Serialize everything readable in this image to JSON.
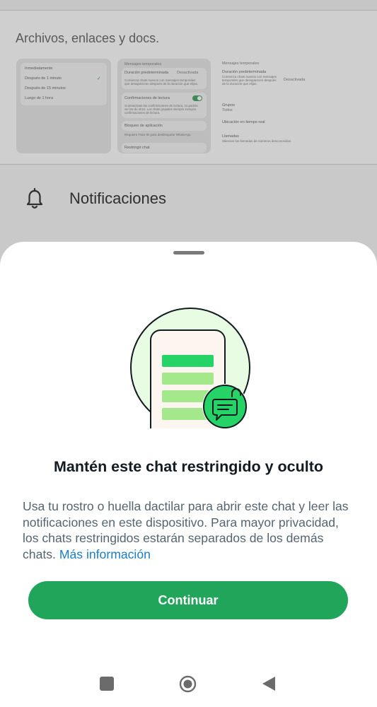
{
  "background": {
    "media_section_title": "Archivos, enlaces y docs.",
    "thumbnail_1": {
      "options": [
        "Inmediatamente",
        "Después de 1 minuto",
        "Después de 15 minutos",
        "Luego de 1 hora"
      ],
      "selected_check": "✓"
    },
    "thumbnail_2": {
      "section_label": "Mensajes temporales",
      "duration_label": "Duración predeterminada",
      "duration_value": "Desactivada",
      "duration_desc": "Comienza chats nuevos con mensajes temporales que desaparecen después de la duración que elijas.",
      "read_receipts_label": "Confirmaciones de lectura",
      "read_receipts_desc": "Si desactivas las confirmaciones de lectura, no podrás ver las de otros. Los chats grupales siempre incluyen confirmaciones de lectura.",
      "app_lock_label": "Bloqueo de aplicación",
      "app_lock_desc": "Requiere Face ID para desbloquear WhatsApp.",
      "restrict_chat_label": "Restringir chat"
    },
    "thumbnail_3": {
      "section_label": "Mensajes temporales",
      "duration_label": "Duración predeterminada",
      "duration_desc": "Comienza chats nuevos con mensajes temporales que desaparecen después de la duración que elijas.",
      "duration_value": "Desactivada",
      "groups_label": "Grupos",
      "groups_value": "Todos",
      "live_location_label": "Ubicación en tiempo real",
      "calls_label": "Llamadas",
      "calls_desc": "Silenciar los llamadas de números desconocidos"
    },
    "notifications_label": "Notificaciones"
  },
  "sheet": {
    "title": "Mantén este chat restringido y oculto",
    "body": "Usa tu rostro o huella dactilar para abrir este chat y leer las notificaciones en este dispositivo. Para mayor privacidad, los chats restringidos estarán separados de los demás chats.",
    "link": "Más información",
    "continue_label": "Continuar"
  },
  "colors": {
    "accent": "#21a55a",
    "link": "#1a7dc9",
    "title": "#111b21",
    "body": "#54656f"
  },
  "icons": {
    "notifications": "bell-icon",
    "illustration": "locked-chat-illustration",
    "nav_recents": "square-icon",
    "nav_home": "circle-icon",
    "nav_back": "triangle-back-icon"
  }
}
